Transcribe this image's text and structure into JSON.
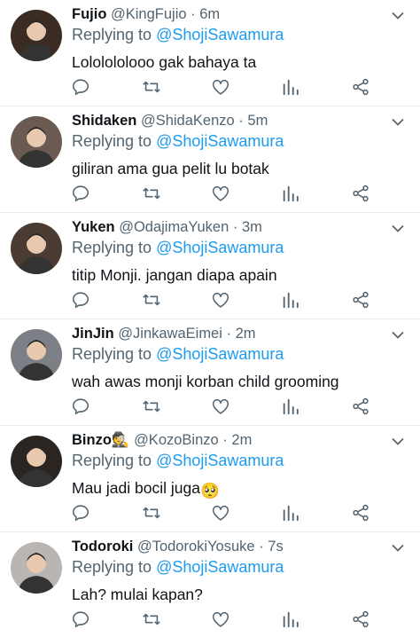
{
  "tweets": [
    {
      "display_name": "Fujio",
      "emoji": "",
      "handle": "@KingFujio",
      "separator": "·",
      "time": "6m",
      "replying_prefix": "Replying to",
      "replying_to": "@ShojiSawamura",
      "text": "Lololololooo gak bahaya ta",
      "avatar_color": "#3a2c22"
    },
    {
      "display_name": "Shidaken",
      "emoji": "",
      "handle": "@ShidaKenzo",
      "separator": "·",
      "time": "5m",
      "replying_prefix": "Replying to",
      "replying_to": "@ShojiSawamura",
      "text": "giliran ama gua pelit lu botak",
      "avatar_color": "#6b5a52"
    },
    {
      "display_name": "Yuken",
      "emoji": "",
      "handle": "@OdajimaYuken",
      "separator": "·",
      "time": "3m",
      "replying_prefix": "Replying to",
      "replying_to": "@ShojiSawamura",
      "text": "titip Monji. jangan diapa apain",
      "avatar_color": "#4a3b33"
    },
    {
      "display_name": "JinJin",
      "emoji": "",
      "handle": "@JinkawaEimei",
      "separator": "·",
      "time": "2m",
      "replying_prefix": "Replying to",
      "replying_to": "@ShojiSawamura",
      "text": "wah awas monji korban child grooming",
      "avatar_color": "#7d7f86"
    },
    {
      "display_name": "Binzo",
      "emoji": "🕵",
      "handle": "@KozoBinzo",
      "separator": "·",
      "time": "2m",
      "replying_prefix": "Replying to",
      "replying_to": "@ShojiSawamura",
      "text": "Mau jadi bocil juga",
      "text_emoji": "🥺",
      "avatar_color": "#2b2521"
    },
    {
      "display_name": "Todoroki",
      "emoji": "",
      "handle": "@TodorokiYosuke",
      "separator": "·",
      "time": "7s",
      "replying_prefix": "Replying to",
      "replying_to": "@ShojiSawamura",
      "text": "Lah? mulai kapan?",
      "avatar_color": "#b8b5b2"
    }
  ],
  "icons": {
    "reply": "reply-icon",
    "retweet": "retweet-icon",
    "like": "heart-icon",
    "stats": "analytics-icon",
    "share": "share-icon",
    "more": "chevron-down-icon"
  },
  "colors": {
    "link": "#1d9bf0",
    "muted": "#536471",
    "text": "#0f1419",
    "divider": "#e6ecf0"
  }
}
